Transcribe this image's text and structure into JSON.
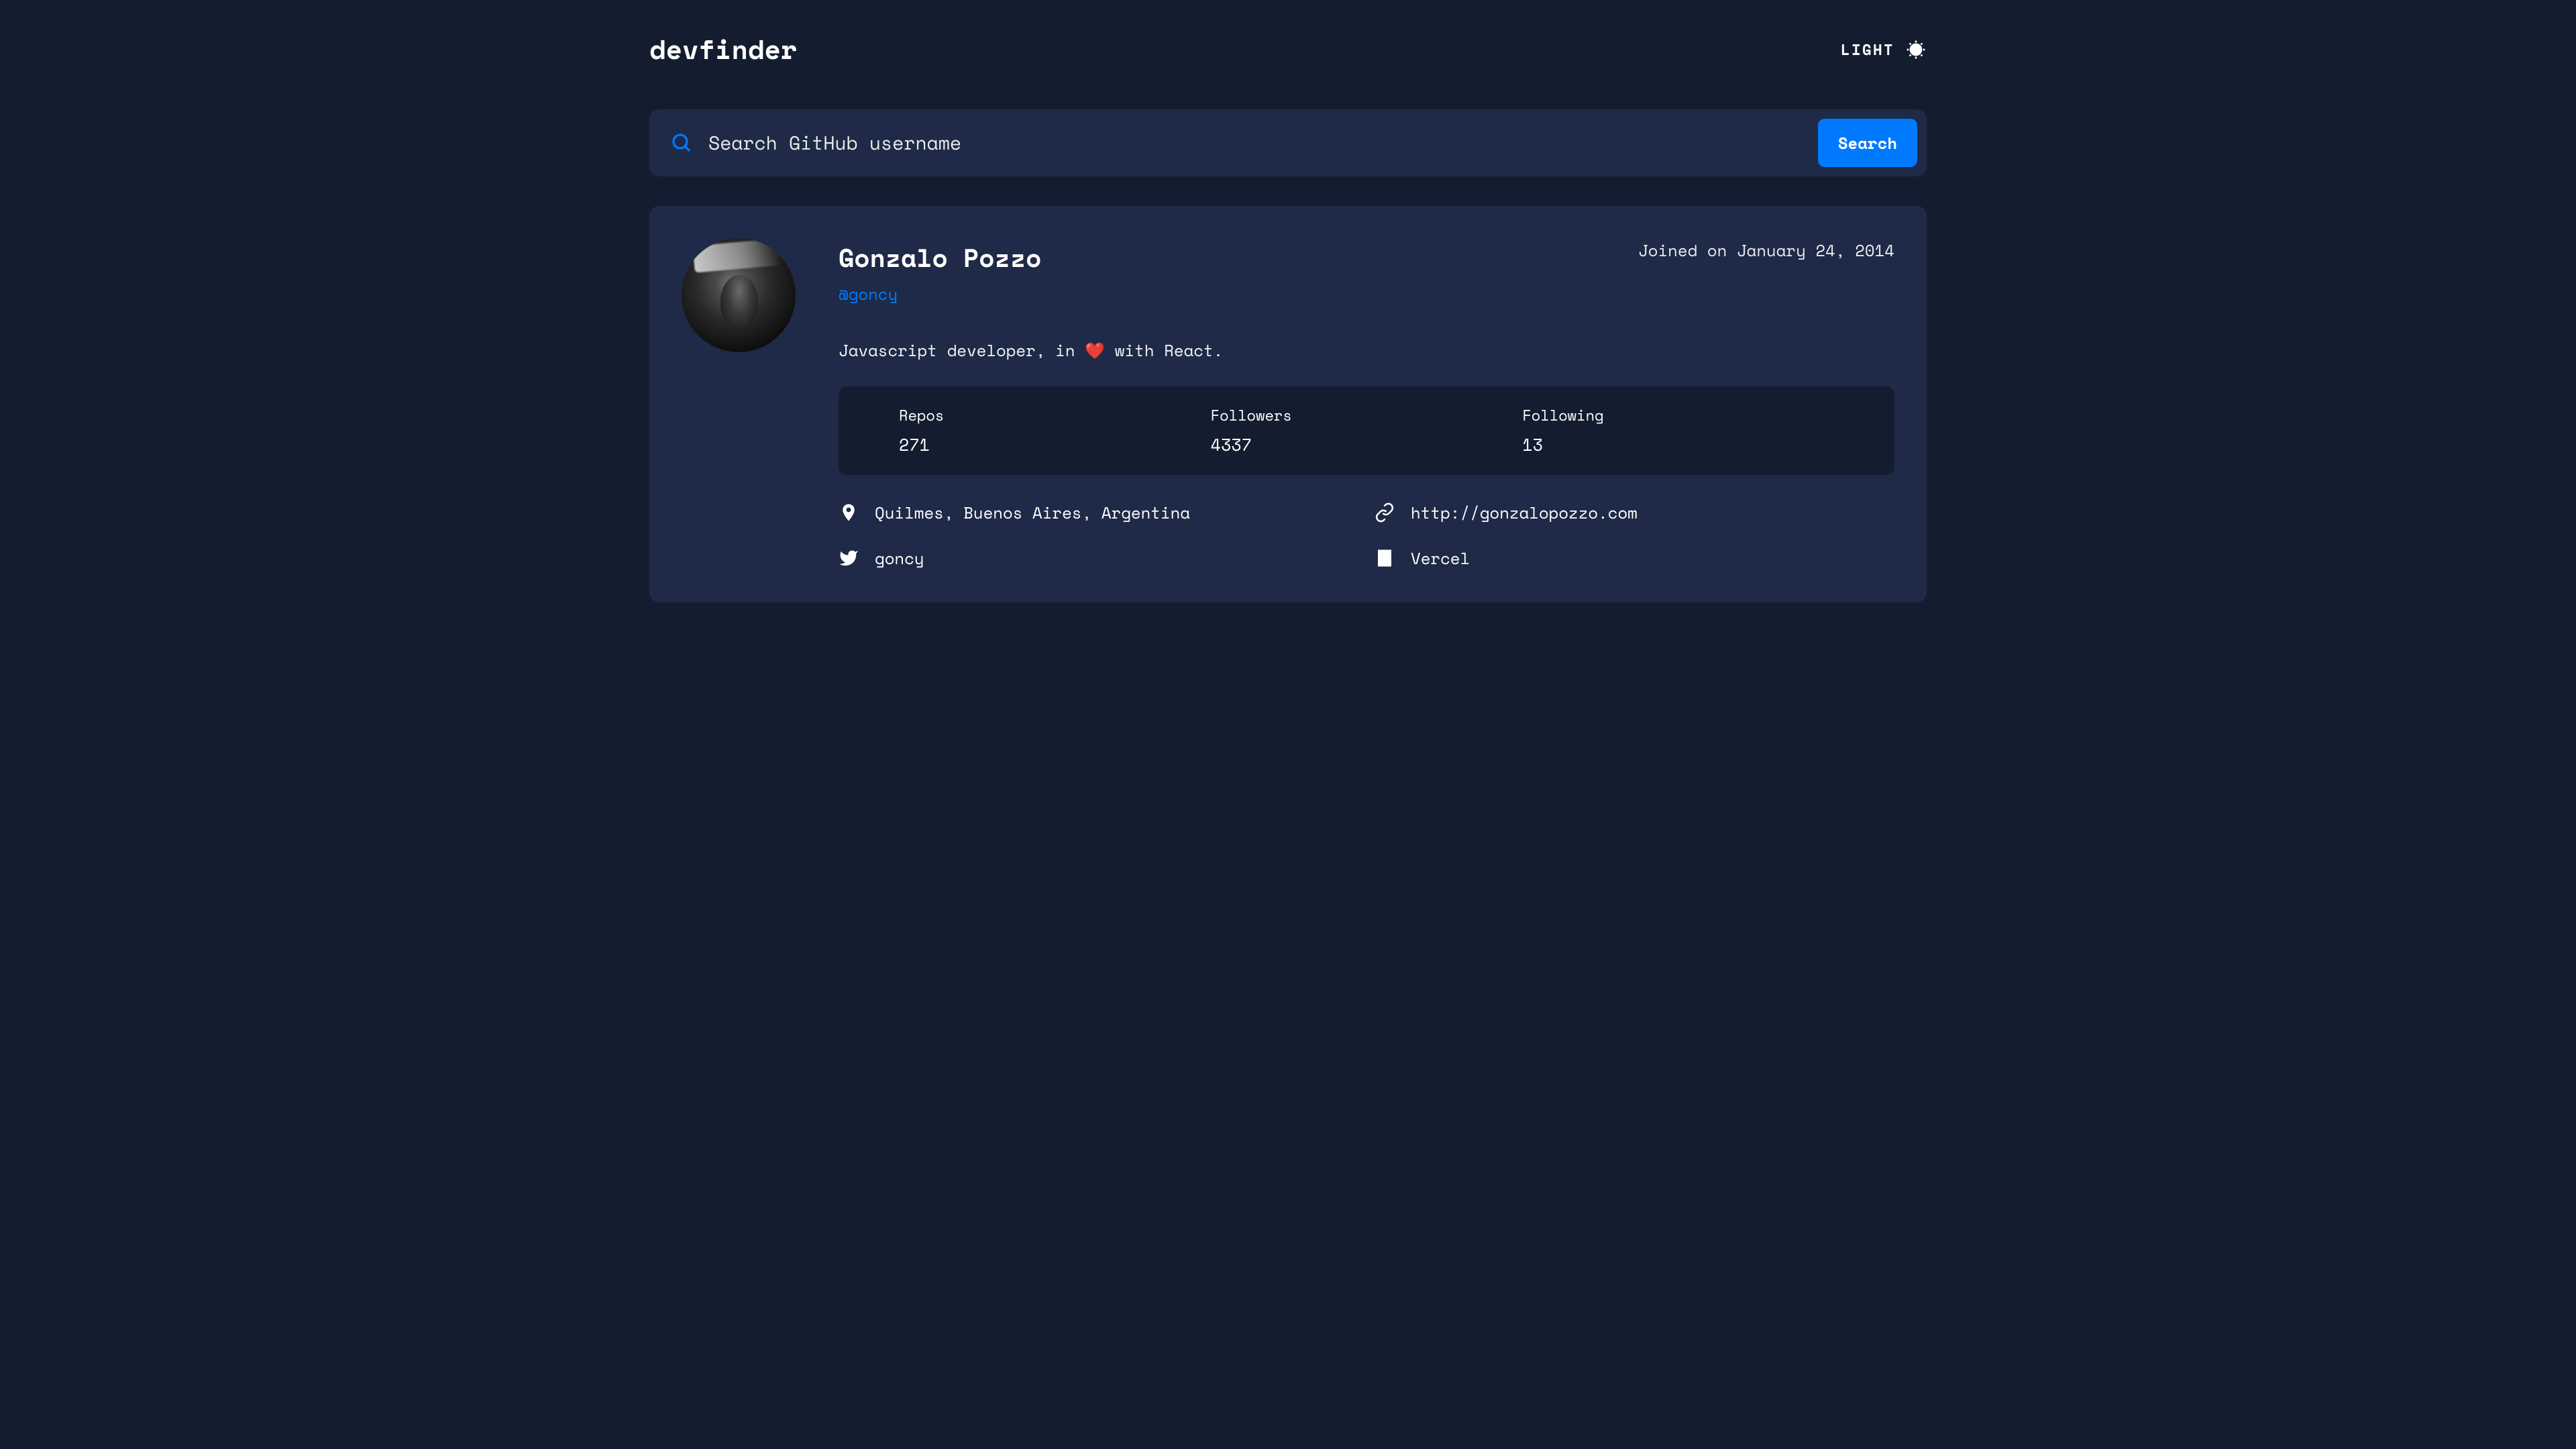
{
  "header": {
    "logo": "devfinder",
    "theme_label": "LIGHT"
  },
  "search": {
    "placeholder": "Search GitHub username",
    "button_label": "Search"
  },
  "profile": {
    "name": "Gonzalo Pozzo",
    "username": "@goncy",
    "joined": "Joined on January 24, 2014",
    "bio": "Javascript developer, in ❤️ with React.",
    "stats": {
      "repos_label": "Repos",
      "repos_value": "271",
      "followers_label": "Followers",
      "followers_value": "4337",
      "following_label": "Following",
      "following_value": "13"
    },
    "links": {
      "location": "Quilmes, Buenos Aires, Argentina",
      "website": "http://gonzalopozzo.com",
      "twitter": "goncy",
      "company": "Vercel"
    }
  }
}
